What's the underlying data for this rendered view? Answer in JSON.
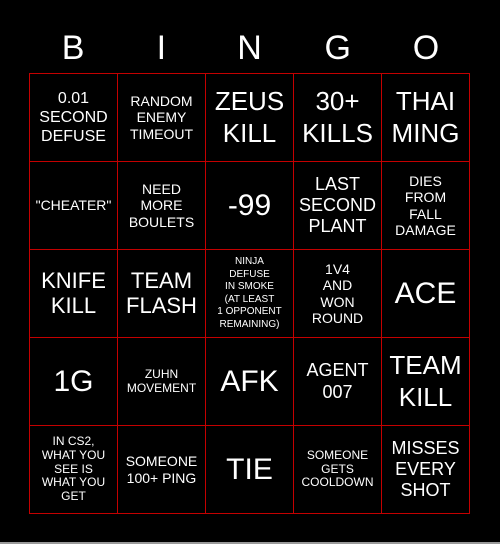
{
  "header": {
    "letters": [
      "B",
      "I",
      "N",
      "G",
      "O"
    ]
  },
  "colors": {
    "background": "#000000",
    "grid_line": "#c40000",
    "text": "#ffffff"
  },
  "cells": [
    [
      "0.01\nSECOND\nDEFUSE",
      "RANDOM\nENEMY\nTIMEOUT",
      "ZEUS\nKILL",
      "30+\nKILLS",
      "THAI\nMING"
    ],
    [
      "\"CHEATER\"",
      "NEED\nMORE\nBOULETS",
      "-99",
      "LAST\nSECOND\nPLANT",
      "DIES\nFROM\nFALL\nDAMAGE"
    ],
    [
      "KNIFE\nKILL",
      "TEAM\nFLASH",
      "NINJA\nDEFUSE\nIN SMOKE\n(AT LEAST\n1 OPPONENT\nREMAINING)",
      "1V4\nAND\nWON\nROUND",
      "ACE"
    ],
    [
      "1G",
      "ZUHN\nMOVEMENT",
      "AFK",
      "AGENT\n007",
      "TEAM\nKILL"
    ],
    [
      "IN CS2,\nWHAT YOU\nSEE IS\nWHAT YOU\nGET",
      "SOMEONE\n100+ PING",
      "TIE",
      "SOMEONE\nGETS\nCOOLDOWN",
      "MISSES\nEVERY\nSHOT"
    ]
  ]
}
